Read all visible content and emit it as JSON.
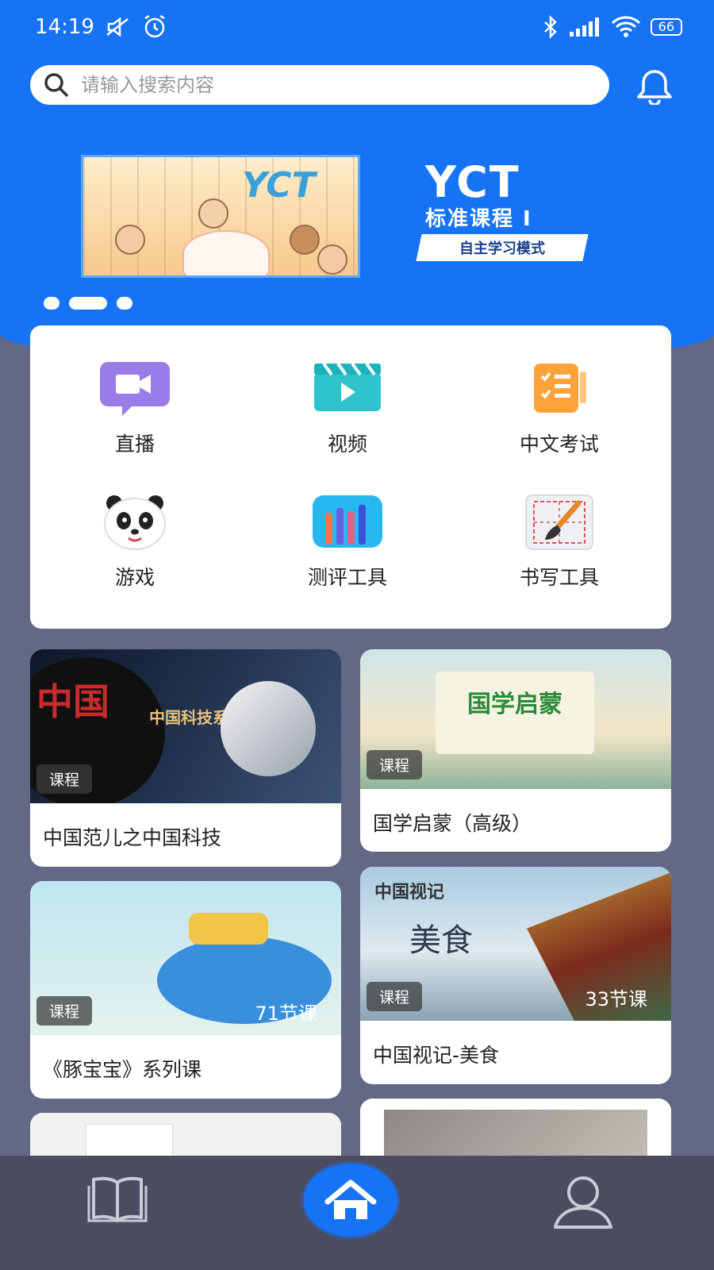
{
  "status_bar": {
    "time": "14:19",
    "battery": "66",
    "icons": [
      "mute-icon",
      "alarm-icon",
      "bluetooth-icon",
      "signal-icon",
      "wifi-icon",
      "battery-icon"
    ]
  },
  "search": {
    "placeholder": "请输入搜索内容"
  },
  "banner": {
    "image_text": "YCT",
    "title": "YCT",
    "subtitle": "标准课程 I",
    "tag": "自主学习模式",
    "dots": 3,
    "active_dot": 1
  },
  "menu": {
    "items": [
      {
        "label": "直播",
        "icon": "live-video-icon"
      },
      {
        "label": "视频",
        "icon": "video-clapper-icon"
      },
      {
        "label": "中文考试",
        "icon": "exam-checklist-icon"
      },
      {
        "label": "游戏",
        "icon": "panda-game-icon"
      },
      {
        "label": "测评工具",
        "icon": "assessment-bars-icon"
      },
      {
        "label": "书写工具",
        "icon": "brush-writing-icon"
      }
    ]
  },
  "courses": [
    {
      "title": "中国范儿之中国科技",
      "badge": "课程",
      "lessons": "",
      "thumb_text": "中国科技系列"
    },
    {
      "title": "国学启蒙（高级）",
      "badge": "课程",
      "lessons": "",
      "thumb_text": "国学启蒙"
    },
    {
      "title": "《豚宝宝》系列课",
      "badge": "课程",
      "lessons": "71节课",
      "thumb_text": ""
    },
    {
      "title": "中国视记-美食",
      "badge": "课程",
      "lessons": "33节课",
      "thumb_text": "中国视记"
    }
  ],
  "thumb_extra": {
    "fan_title": "中国",
    "meishi": "美食"
  },
  "colors": {
    "brand_blue": "#1673f5",
    "page_bg": "#646887",
    "nav_bg": "#4b4c62"
  },
  "nav": {
    "items": [
      "book-icon",
      "home-icon",
      "user-icon"
    ]
  }
}
